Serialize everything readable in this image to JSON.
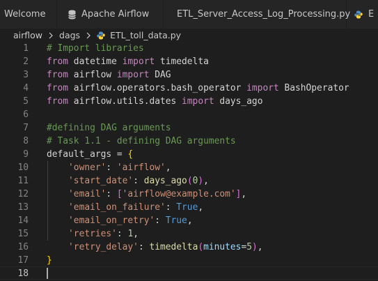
{
  "tabs": [
    {
      "label": "Welcome",
      "icon": "none"
    },
    {
      "label": "Apache Airflow",
      "icon": "database-icon"
    },
    {
      "label": "ETL_Server_Access_Log_Processing.py",
      "icon": "python-icon"
    },
    {
      "label": "E",
      "icon": "python-icon"
    }
  ],
  "breadcrumb": [
    "airflow",
    "dags",
    "ETL_toll_data.py"
  ],
  "colors": {
    "background": "#1e1e1e",
    "comment": "#6a9955",
    "keyword": "#c586c0",
    "string": "#ce9178",
    "function": "#dcdcaa",
    "number": "#b5cea8",
    "constant": "#569cd6",
    "parameter": "#9cdcfe"
  },
  "editor": {
    "active_line": 18,
    "lines": [
      {
        "num": "1",
        "tokens": [
          {
            "t": "comment",
            "v": "# Import libraries"
          }
        ]
      },
      {
        "num": "2",
        "tokens": [
          {
            "t": "kw",
            "v": "from"
          },
          {
            "t": "plain",
            "v": " datetime "
          },
          {
            "t": "kw",
            "v": "import"
          },
          {
            "t": "plain",
            "v": " timedelta"
          }
        ]
      },
      {
        "num": "3",
        "tokens": [
          {
            "t": "kw",
            "v": "from"
          },
          {
            "t": "plain",
            "v": " airflow "
          },
          {
            "t": "kw",
            "v": "import"
          },
          {
            "t": "plain",
            "v": " DAG"
          }
        ]
      },
      {
        "num": "4",
        "tokens": [
          {
            "t": "kw",
            "v": "from"
          },
          {
            "t": "plain",
            "v": " airflow.operators.bash_operator "
          },
          {
            "t": "kw",
            "v": "import"
          },
          {
            "t": "plain",
            "v": " BashOperator"
          }
        ]
      },
      {
        "num": "5",
        "tokens": [
          {
            "t": "kw",
            "v": "from"
          },
          {
            "t": "plain",
            "v": " airflow.utils.dates "
          },
          {
            "t": "kw",
            "v": "import"
          },
          {
            "t": "plain",
            "v": " days_ago"
          }
        ]
      },
      {
        "num": "6",
        "tokens": []
      },
      {
        "num": "7",
        "tokens": [
          {
            "t": "comment",
            "v": "#defining DAG arguments"
          }
        ]
      },
      {
        "num": "8",
        "tokens": [
          {
            "t": "comment",
            "v": "# Task 1.1 - defining DAG arguments"
          }
        ]
      },
      {
        "num": "9",
        "tokens": [
          {
            "t": "plain",
            "v": "default_args = "
          },
          {
            "t": "brace",
            "v": "{"
          }
        ]
      },
      {
        "num": "10",
        "tokens": [
          {
            "t": "plain",
            "v": "    "
          },
          {
            "t": "str",
            "v": "'owner'"
          },
          {
            "t": "plain",
            "v": ": "
          },
          {
            "t": "str",
            "v": "'airflow'"
          },
          {
            "t": "plain",
            "v": ","
          }
        ]
      },
      {
        "num": "11",
        "tokens": [
          {
            "t": "plain",
            "v": "    "
          },
          {
            "t": "str",
            "v": "'start_date'"
          },
          {
            "t": "plain",
            "v": ": "
          },
          {
            "t": "fn",
            "v": "days_ago"
          },
          {
            "t": "paren",
            "v": "("
          },
          {
            "t": "num",
            "v": "0"
          },
          {
            "t": "paren",
            "v": ")"
          },
          {
            "t": "plain",
            "v": ","
          }
        ]
      },
      {
        "num": "12",
        "tokens": [
          {
            "t": "plain",
            "v": "    "
          },
          {
            "t": "str",
            "v": "'email'"
          },
          {
            "t": "plain",
            "v": ": "
          },
          {
            "t": "paren",
            "v": "["
          },
          {
            "t": "str",
            "v": "'airflow@example.com'"
          },
          {
            "t": "paren",
            "v": "]"
          },
          {
            "t": "plain",
            "v": ","
          }
        ]
      },
      {
        "num": "13",
        "tokens": [
          {
            "t": "plain",
            "v": "    "
          },
          {
            "t": "str",
            "v": "'email_on_failure'"
          },
          {
            "t": "plain",
            "v": ": "
          },
          {
            "t": "const",
            "v": "True"
          },
          {
            "t": "plain",
            "v": ","
          }
        ]
      },
      {
        "num": "14",
        "tokens": [
          {
            "t": "plain",
            "v": "    "
          },
          {
            "t": "str",
            "v": "'email_on_retry'"
          },
          {
            "t": "plain",
            "v": ": "
          },
          {
            "t": "const",
            "v": "True"
          },
          {
            "t": "plain",
            "v": ","
          }
        ]
      },
      {
        "num": "15",
        "tokens": [
          {
            "t": "plain",
            "v": "    "
          },
          {
            "t": "str",
            "v": "'retries'"
          },
          {
            "t": "plain",
            "v": ": "
          },
          {
            "t": "num",
            "v": "1"
          },
          {
            "t": "plain",
            "v": ","
          }
        ]
      },
      {
        "num": "16",
        "tokens": [
          {
            "t": "plain",
            "v": "    "
          },
          {
            "t": "str",
            "v": "'retry_delay'"
          },
          {
            "t": "plain",
            "v": ": "
          },
          {
            "t": "fn",
            "v": "timedelta"
          },
          {
            "t": "paren",
            "v": "("
          },
          {
            "t": "param",
            "v": "minutes"
          },
          {
            "t": "plain",
            "v": "="
          },
          {
            "t": "num",
            "v": "5"
          },
          {
            "t": "paren",
            "v": ")"
          },
          {
            "t": "plain",
            "v": ","
          }
        ]
      },
      {
        "num": "17",
        "tokens": [
          {
            "t": "brace",
            "v": "}"
          }
        ]
      },
      {
        "num": "18",
        "tokens": []
      }
    ]
  }
}
